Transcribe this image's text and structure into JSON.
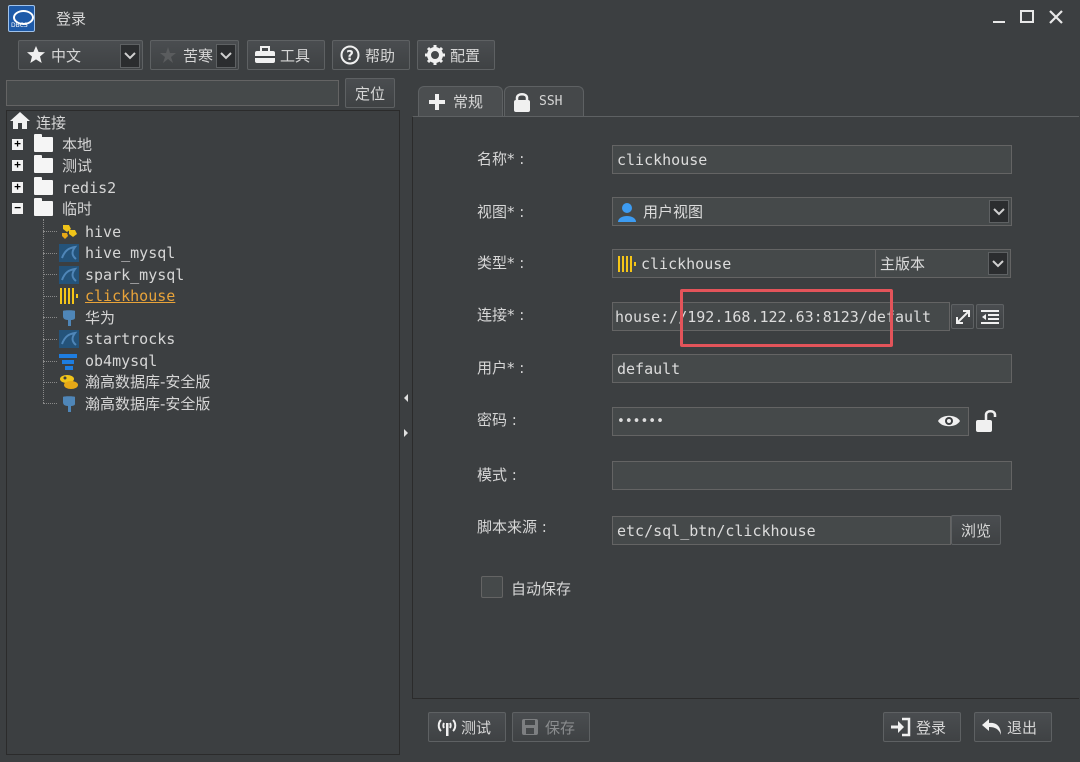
{
  "window": {
    "title": "登录"
  },
  "toolbar": {
    "language": "中文",
    "theme": "苦寒",
    "tools_label": "工具",
    "help_label": "帮助",
    "config_label": "配置"
  },
  "left": {
    "search_value": "",
    "locate_label": "定位",
    "tree": {
      "root": "连接",
      "folders": [
        "本地",
        "测试",
        "redis2",
        "临时"
      ],
      "items": [
        "hive",
        "hive_mysql",
        "spark_mysql",
        "clickhouse",
        "华为",
        "startrocks",
        "ob4mysql",
        "瀚高数据库-安全版",
        "瀚高数据库-安全版"
      ],
      "selected": "clickhouse"
    }
  },
  "tabs": {
    "general": "常规",
    "ssh": "SSH"
  },
  "form": {
    "name_label": "名称* :",
    "name_value": "clickhouse",
    "view_label": "视图* :",
    "view_value": "用户视图",
    "type_label": "类型* :",
    "type_value": "clickhouse",
    "version_value": "主版本",
    "connect_label": "连接* :",
    "connect_value": "house://192.168.122.63:8123/default",
    "user_label": "用户* :",
    "user_value": "default",
    "password_label": "密码 :",
    "password_value": "••••••",
    "schema_label": "模式 :",
    "schema_value": "",
    "script_label": "脚本来源 :",
    "script_value": "etc/sql_btn/clickhouse",
    "browse_label": "浏览",
    "autosave_label": "自动保存",
    "autosave_checked": false
  },
  "bottom": {
    "test_label": "测试",
    "save_label": "保存",
    "login_label": "登录",
    "exit_label": "退出"
  },
  "colors": {
    "highlight": "#e3545a",
    "selected": "#e8a33a",
    "user_icon": "#3d9cf2"
  }
}
